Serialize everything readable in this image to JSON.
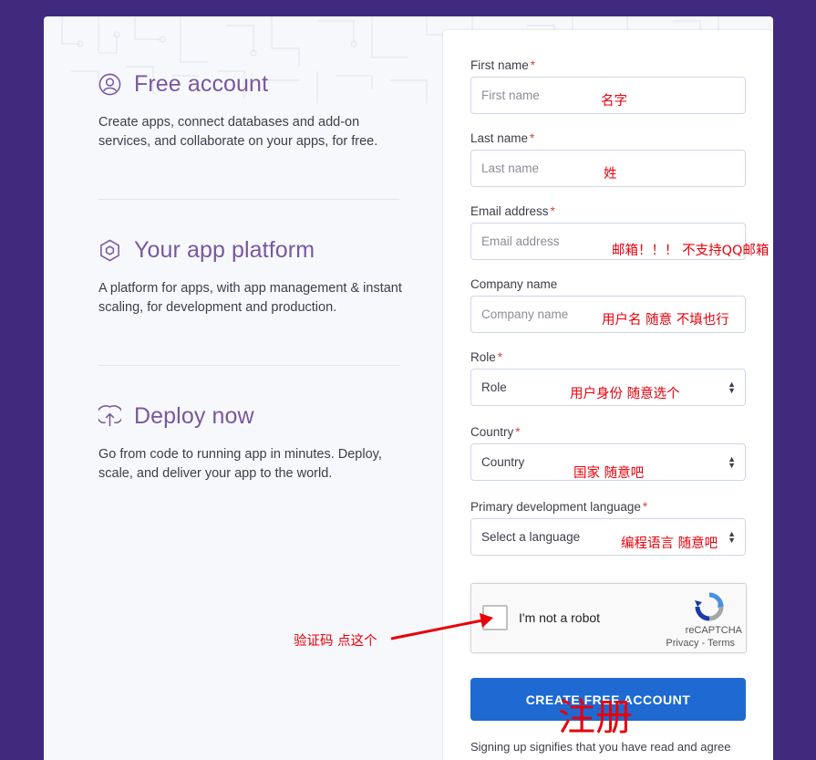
{
  "features": [
    {
      "title": "Free account",
      "desc": "Create apps, connect databases and add-on services, and collaborate on your apps, for free.",
      "icon": "user-circle-icon"
    },
    {
      "title": "Your app platform",
      "desc": "A platform for apps, with app management & instant scaling, for development and production.",
      "icon": "hexagon-icon"
    },
    {
      "title": "Deploy now",
      "desc": "Go from code to running app in minutes. Deploy, scale, and deliver your app to the world.",
      "icon": "upload-arrow-icon"
    }
  ],
  "form": {
    "first_name": {
      "label": "First name",
      "placeholder": "First name",
      "required": "*"
    },
    "last_name": {
      "label": "Last name",
      "placeholder": "Last name",
      "required": "*"
    },
    "email": {
      "label": "Email address",
      "placeholder": "Email address",
      "required": "*"
    },
    "company": {
      "label": "Company name",
      "placeholder": "Company name"
    },
    "role": {
      "label": "Role",
      "value": "Role",
      "required": "*"
    },
    "country": {
      "label": "Country",
      "value": "Country",
      "required": "*"
    },
    "language": {
      "label": "Primary development language",
      "value": "Select a language",
      "required": "*"
    },
    "submit_label": "CREATE FREE ACCOUNT",
    "signup_note": "Signing up signifies that you have read and agree"
  },
  "captcha": {
    "label": "I'm not a robot",
    "brand": "reCAPTCHA",
    "privacy": "Privacy",
    "sep": " - ",
    "terms": "Terms"
  },
  "annotations": {
    "first_name": "名字",
    "last_name": "姓",
    "email": "邮箱！！！ 不支持QQ邮箱",
    "company": "用户名 随意 不填也行",
    "role": "用户身份 随意选个",
    "country": "国家  随意吧",
    "language": "编程语言 随意吧",
    "captcha": "验证码  点这个",
    "submit": "注册"
  },
  "colors": {
    "background": "#3f2a7e",
    "accent": "#79589f",
    "button": "#1e6ad2",
    "annotation": "#e8000b"
  }
}
